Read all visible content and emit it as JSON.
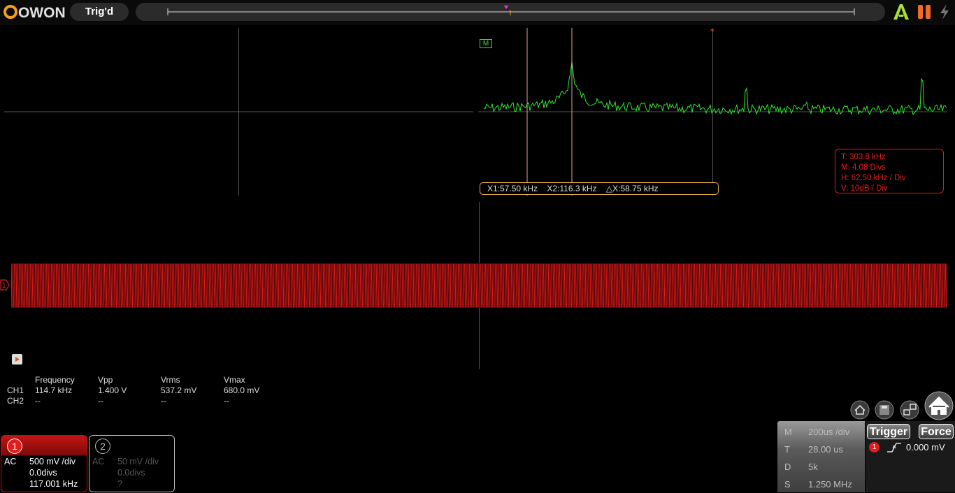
{
  "brand": "OWON",
  "trigger_status": "Trig'd",
  "top_icons": [
    "auto-icon",
    "pause-icon",
    "bolt-icon"
  ],
  "math_label": "M",
  "ch1_marker": "1",
  "fft": {
    "cursor_readout": {
      "x1": "X1:57.50 kHz",
      "x2": "X2:116.3 kHz",
      "dx": "△X:58.75 kHz"
    },
    "info": {
      "t": "T: 303.8 kHz",
      "m": "M: 4.08 Divs",
      "h": "H: 62.50 kHz / Div",
      "v": "V: 10dB  / Div"
    }
  },
  "measurements": {
    "headers": [
      "Frequency",
      "Vpp",
      "Vrms",
      "Vmax"
    ],
    "rows": [
      {
        "ch": "CH1",
        "values": [
          "114.7 kHz",
          "1.400 V",
          "537.2 mV",
          "680.0 mV"
        ]
      },
      {
        "ch": "CH2",
        "values": [
          "--",
          "--",
          "--",
          "--"
        ]
      }
    ]
  },
  "channels": [
    {
      "num": "1",
      "coupling": "AC",
      "scale": "500 mV /div",
      "offset": "0.0divs",
      "freq": "117.001 kHz"
    },
    {
      "num": "2",
      "coupling": "AC",
      "scale": "50 mV /div",
      "offset": "0.0divs",
      "freq": "?"
    }
  ],
  "timebase": {
    "m": {
      "k": "M",
      "v": "200us /div"
    },
    "t": {
      "k": "T",
      "v": "28.00 us"
    },
    "d": {
      "k": "D",
      "v": "5k"
    },
    "s": {
      "k": "S",
      "v": "1.250 MHz"
    }
  },
  "trigger": {
    "trigger_btn": "Trigger",
    "force_btn": "Force",
    "source": "1",
    "level": "0.000 mV"
  },
  "colors": {
    "ch1": "#e21c1c",
    "math": "#2ee82e",
    "cursor": "#e8b23a",
    "grid": "#555555"
  }
}
